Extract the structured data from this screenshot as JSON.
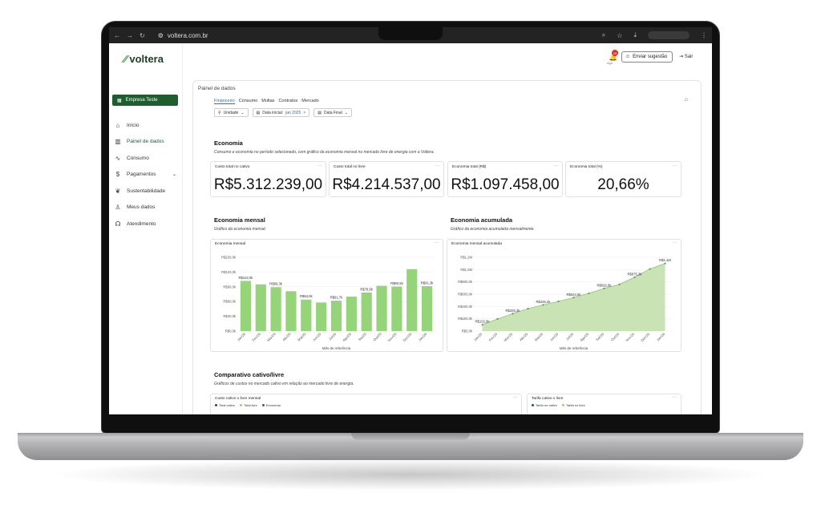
{
  "browser": {
    "url": "voltera.com.br"
  },
  "brand": {
    "name": "voltera",
    "logo_mark": "⁄⁄",
    "accent": "#1f5c2e",
    "bar_color": "#96d47a",
    "area_color": "#c9e3b4"
  },
  "sidebar": {
    "company": "Empresa Teste",
    "items": [
      {
        "label": "Início",
        "icon": "home-icon",
        "active": false
      },
      {
        "label": "Painel de dados",
        "icon": "dashboard-icon",
        "active": true
      },
      {
        "label": "Consumo",
        "icon": "chart-line-icon",
        "active": false
      },
      {
        "label": "Pagamentos",
        "icon": "dollar-icon",
        "active": false,
        "has_children": true
      },
      {
        "label": "Sustentabilidade",
        "icon": "leaf-icon",
        "active": false
      },
      {
        "label": "Meus dados",
        "icon": "user-icon",
        "active": false
      },
      {
        "label": "Atendimento",
        "icon": "headset-icon",
        "active": false
      }
    ]
  },
  "topbar": {
    "notification_count": "10",
    "notification_date": "Ago",
    "suggest_label": "Enviar sugestão",
    "logout_label": "Sair"
  },
  "panel": {
    "title": "Painel de dados",
    "tabs": [
      "Financeiro",
      "Consumo",
      "Multas",
      "Contratos",
      "Mercado"
    ],
    "active_tab": "Financeiro",
    "filters": {
      "unidade": "Unidade",
      "data_inicial_label": "Data inicial:",
      "data_inicial_value": "jan 2025",
      "data_final": "Data Final"
    }
  },
  "economia": {
    "title": "Economia",
    "subtitle": "Consumo e economia no período selecionado, com gráfico da economia mensal no mercado livre de energia com a Voltera.",
    "kpis": [
      {
        "label": "Custo total no cativo",
        "value": "R$5.312.239,00"
      },
      {
        "label": "Custo total no livre",
        "value": "R$4.214.537,00"
      },
      {
        "label": "Economia total (R$)",
        "value": "R$1.097.458,00"
      },
      {
        "label": "Economia total (%)",
        "value": "20,66%"
      }
    ]
  },
  "monthly": {
    "title": "Economia mensal",
    "subtitle": "Gráfico da economia mensal.",
    "card_label": "Economia mensal"
  },
  "cumulative": {
    "title": "Economia acumulada",
    "subtitle": "Gráfico da economia acumulada mensalmente.",
    "card_label": "Economia mensal acumulada"
  },
  "comparativo": {
    "title": "Comparativo cativo/livre",
    "subtitle": "Gráficos de custos no mercado cativo em relação ao mercado livre de energia.",
    "card1_label": "Custo cativo x livre mensal",
    "card1_legend": [
      {
        "label": "Total cativo",
        "color": "#1f5c2e"
      },
      {
        "label": "Total livre",
        "color": "#96d47a"
      },
      {
        "label": "Economia",
        "color": "#555555"
      }
    ],
    "card2_label": "Tarifa cativo x livre",
    "card2_legend": [
      {
        "label": "Tarifa no cativo",
        "color": "#1f5c2e"
      },
      {
        "label": "Tarifa no livre",
        "color": "#96d47a"
      }
    ]
  },
  "chart_data": [
    {
      "type": "bar",
      "title": "Economia mensal",
      "xlabel": "Mês de referência",
      "categories": [
        "Jan/25",
        "Fev/25",
        "Mar/25",
        "Abr/25",
        "Mai/25",
        "Jun/25",
        "Jul/25",
        "Ago/25",
        "Set/25",
        "Out/25",
        "Nov/25",
        "Dez/25",
        "Jan/26"
      ],
      "values": [
        102.0,
        95.0,
        89.3,
        81.0,
        64.0,
        58.0,
        61.7,
        70.0,
        78.5,
        92.0,
        90.5,
        126.0,
        91.3
      ],
      "data_labels": {
        "0": "R$102,0k",
        "2": "R$89,3k",
        "4": "R$64,0k",
        "6": "R$61,7k",
        "8": "R$78,5k",
        "10": "R$90,5k",
        "12": "R$91,3k"
      },
      "yticks": [
        "R$0,0k",
        "R$30,0k",
        "R$60,0k",
        "R$90,0k",
        "R$120,0k",
        "R$150,0k"
      ],
      "ylim": [
        0,
        150
      ],
      "units": "R$ k"
    },
    {
      "type": "area",
      "title": "Economia mensal acumulada",
      "xlabel": "Mês de referência",
      "categories": [
        "Jan/25",
        "Fev/25",
        "Mar/25",
        "Abr/25",
        "Mai/25",
        "Jun/25",
        "Jul/25",
        "Ago/25",
        "Set/25",
        "Out/25",
        "Nov/25",
        "Dez/25",
        "Jan/26"
      ],
      "values": [
        102.0,
        197.0,
        283.3,
        364.0,
        425.2,
        483.0,
        544.5,
        614.0,
        692.6,
        760.0,
        875.3,
        1010.0,
        1100.0
      ],
      "data_labels": {
        "0": "R$102,0k",
        "2": "R$283,3k",
        "4": "R$425,2k",
        "6": "R$544,5k",
        "8": "R$692,6k",
        "10": "R$875,3k",
        "12": "R$1,1M"
      },
      "yticks": [
        "R$0,0k",
        "R$200,0k",
        "R$400,0k",
        "R$600,0k",
        "R$800,0k",
        "R$1,0M",
        "R$1,2M"
      ],
      "ylim": [
        0,
        1200
      ],
      "units": "R$ k"
    }
  ]
}
